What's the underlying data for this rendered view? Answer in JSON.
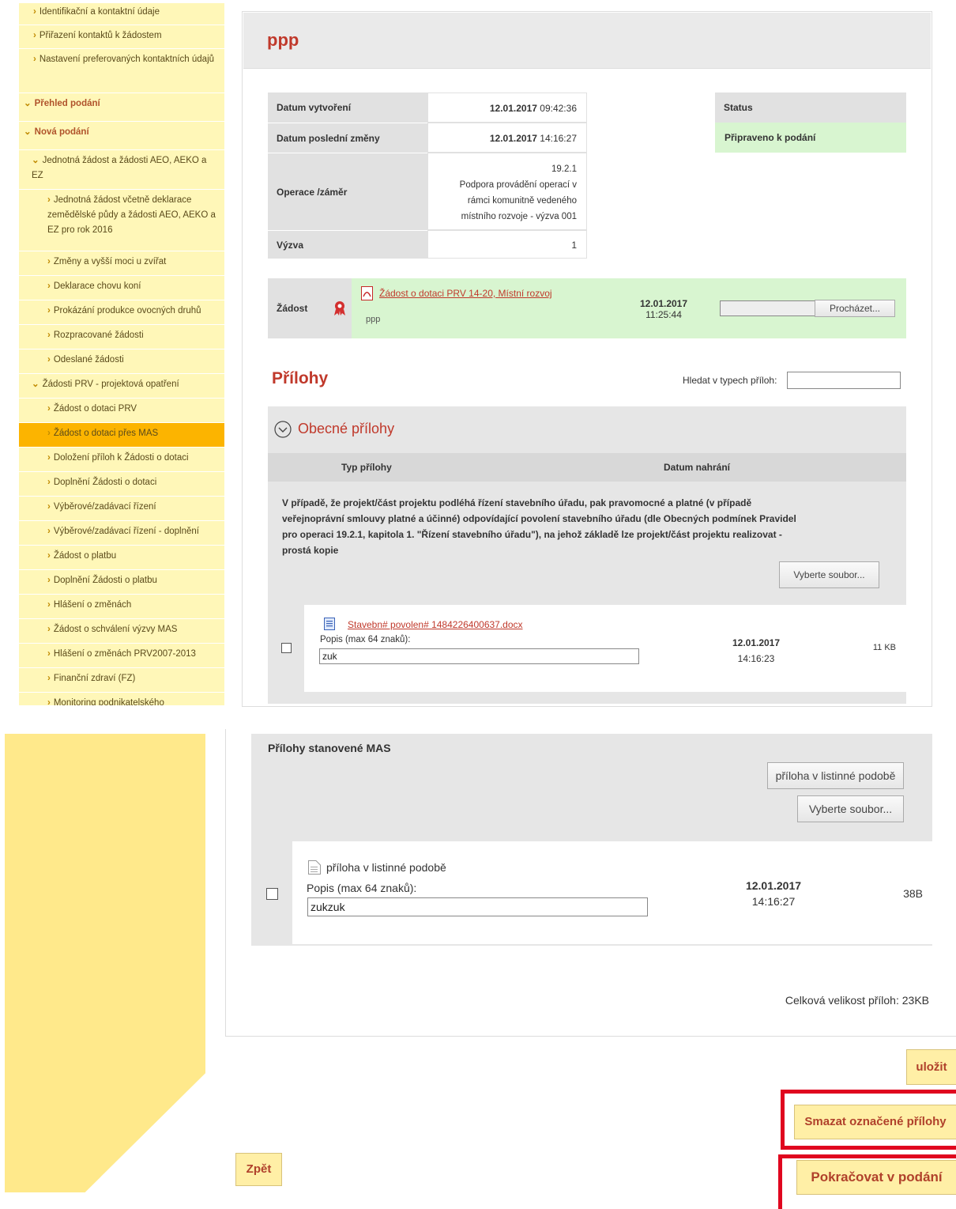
{
  "sidebar": {
    "items": [
      {
        "label": "Identifikační a kontaktní údaje",
        "kind": "child"
      },
      {
        "label": "Přiřazení kontaktů k žádostem",
        "kind": "child"
      },
      {
        "label": "Nastavení preferovaných kontaktních údajů",
        "kind": "child"
      },
      {
        "label": "Přehled podání",
        "kind": "section"
      },
      {
        "label": "Nová podání",
        "kind": "section"
      },
      {
        "label": "Jednotná žádost a žádosti AEO, AEKO a EZ",
        "kind": "group"
      },
      {
        "label": "Jednotná žádost včetně deklarace zemědělské půdy a žádosti AEO, AEKO a EZ pro rok 2016",
        "kind": "sub"
      },
      {
        "label": "Změny a vyšší moci u zvířat",
        "kind": "sub"
      },
      {
        "label": "Deklarace chovu koní",
        "kind": "sub"
      },
      {
        "label": "Prokázání produkce ovocných druhů",
        "kind": "sub"
      },
      {
        "label": "Rozpracované žádosti",
        "kind": "sub"
      },
      {
        "label": "Odeslané žádosti",
        "kind": "sub"
      },
      {
        "label": "Žádosti PRV - projektová opatření",
        "kind": "group"
      },
      {
        "label": "Žádost o dotaci PRV",
        "kind": "sub"
      },
      {
        "label": "Žádost o dotaci přes MAS",
        "kind": "sub-active"
      },
      {
        "label": "Doložení příloh k Žádosti o dotaci",
        "kind": "sub"
      },
      {
        "label": "Doplnění Žádosti o dotaci",
        "kind": "sub"
      },
      {
        "label": "Výběrové/zadávací řízení",
        "kind": "sub"
      },
      {
        "label": "Výběrové/zadávací řízení - doplnění",
        "kind": "sub"
      },
      {
        "label": "Žádost o platbu",
        "kind": "sub"
      },
      {
        "label": "Doplnění Žádosti o platbu",
        "kind": "sub"
      },
      {
        "label": "Hlášení o změnách",
        "kind": "sub"
      },
      {
        "label": "Žádost o schválení výzvy MAS",
        "kind": "sub"
      },
      {
        "label": "Hlášení o změnách PRV2007-2013",
        "kind": "sub"
      },
      {
        "label": "Finanční zdraví (FZ)",
        "kind": "sub"
      },
      {
        "label": "Monitoring podnikatelského",
        "kind": "sub"
      }
    ]
  },
  "page": {
    "title": "ppp"
  },
  "info": {
    "created_label": "Datum vytvoření",
    "created_date": "12.01.2017",
    "created_time": "09:42:36",
    "changed_label": "Datum poslední změny",
    "changed_date": "12.01.2017",
    "changed_time": "14:16:27",
    "operation_label": "Operace /záměr",
    "operation_code": "19.2.1",
    "operation_text_1": "Podpora provádění operací v",
    "operation_text_2": "rámci komunitně vedeného",
    "operation_text_3": "místního rozvoje - výzva 001",
    "call_label": "Výzva",
    "call_value": "1",
    "status_label": "Status",
    "status_value": "Připraveno k podání"
  },
  "application": {
    "label": "Žádost",
    "file_link": "Žádost o dotaci PRV 14-20, Místní rozvoj",
    "file_note": "ppp",
    "date": "12.01.2017",
    "time": "11:25:44",
    "browse_label": "Procházet..."
  },
  "attachments": {
    "heading": "Přílohy",
    "search_label": "Hledat v typech příloh:",
    "search_value": "",
    "general": {
      "heading": "Obecné přílohy",
      "col_type": "Typ přílohy",
      "col_date": "Datum nahrání",
      "desc_1": "V případě, že projekt/část projektu podléhá řízení stavebního úřadu, pak pravomocné a platné (v případě",
      "desc_2": "veřejnoprávní smlouvy platné a účinné) odpovídající povolení stavebního úřadu (dle Obecných podmínek Pravidel",
      "desc_3": "pro operaci 19.2.1, kapitola 1. \"Řízení stavebního úřadu\"), na jehož základě lze projekt/část projektu realizovat -",
      "desc_4": "prostá kopie",
      "choose_file": "Vyberte soubor...",
      "file_name": "Stavebn# povolen# 1484226400637.docx",
      "desc_label": "Popis (max 64 znaků):",
      "desc_value": "zuk",
      "date": "12.01.2017",
      "time": "14:16:23",
      "size": "11 KB"
    },
    "mas": {
      "heading": "Přílohy stanovené MAS",
      "paper_btn": "příloha v listinné podobě",
      "choose_file": "Vyberte soubor...",
      "file_name": "příloha v listinné podobě",
      "desc_label": "Popis (max 64 znaků):",
      "desc_value": "zukzuk",
      "date": "12.01.2017",
      "time": "14:16:27",
      "size": "38B"
    },
    "total": "Celková velikost příloh: 23KB"
  },
  "actions": {
    "save": "uložit",
    "delete_selected": "Smazat označené přílohy",
    "continue": "Pokračovat v podání",
    "back": "Zpět"
  },
  "colors": {
    "accent": "#c0392b",
    "sidebar": "#fff7b8",
    "active": "#fcb400",
    "status_bg": "#d8f5d0",
    "highlight": "#e0061f"
  }
}
